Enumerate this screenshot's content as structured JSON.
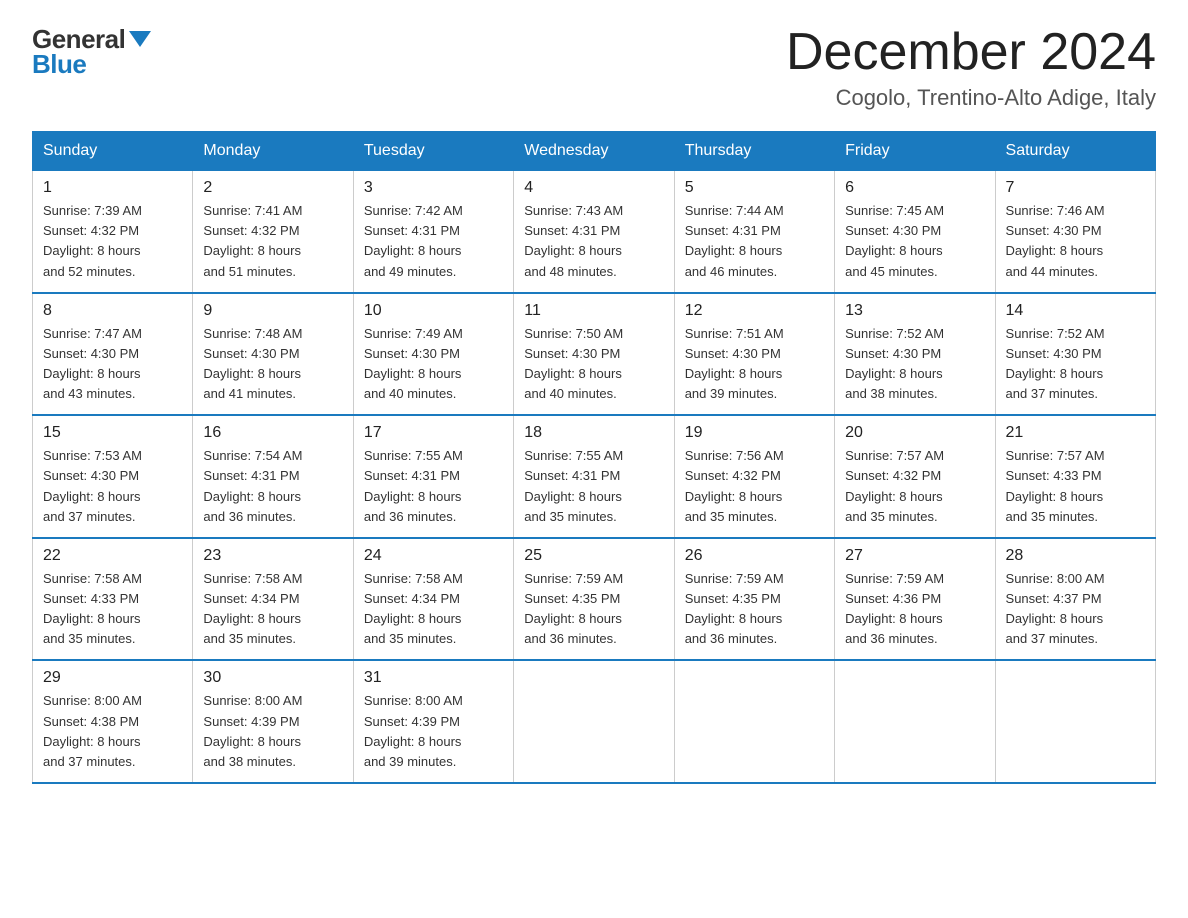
{
  "header": {
    "logo_general": "General",
    "logo_blue": "Blue",
    "month_year": "December 2024",
    "location": "Cogolo, Trentino-Alto Adige, Italy"
  },
  "days_of_week": [
    "Sunday",
    "Monday",
    "Tuesday",
    "Wednesday",
    "Thursday",
    "Friday",
    "Saturday"
  ],
  "weeks": [
    [
      {
        "day": "1",
        "sunrise": "7:39 AM",
        "sunset": "4:32 PM",
        "daylight": "8 hours and 52 minutes."
      },
      {
        "day": "2",
        "sunrise": "7:41 AM",
        "sunset": "4:32 PM",
        "daylight": "8 hours and 51 minutes."
      },
      {
        "day": "3",
        "sunrise": "7:42 AM",
        "sunset": "4:31 PM",
        "daylight": "8 hours and 49 minutes."
      },
      {
        "day": "4",
        "sunrise": "7:43 AM",
        "sunset": "4:31 PM",
        "daylight": "8 hours and 48 minutes."
      },
      {
        "day": "5",
        "sunrise": "7:44 AM",
        "sunset": "4:31 PM",
        "daylight": "8 hours and 46 minutes."
      },
      {
        "day": "6",
        "sunrise": "7:45 AM",
        "sunset": "4:30 PM",
        "daylight": "8 hours and 45 minutes."
      },
      {
        "day": "7",
        "sunrise": "7:46 AM",
        "sunset": "4:30 PM",
        "daylight": "8 hours and 44 minutes."
      }
    ],
    [
      {
        "day": "8",
        "sunrise": "7:47 AM",
        "sunset": "4:30 PM",
        "daylight": "8 hours and 43 minutes."
      },
      {
        "day": "9",
        "sunrise": "7:48 AM",
        "sunset": "4:30 PM",
        "daylight": "8 hours and 41 minutes."
      },
      {
        "day": "10",
        "sunrise": "7:49 AM",
        "sunset": "4:30 PM",
        "daylight": "8 hours and 40 minutes."
      },
      {
        "day": "11",
        "sunrise": "7:50 AM",
        "sunset": "4:30 PM",
        "daylight": "8 hours and 40 minutes."
      },
      {
        "day": "12",
        "sunrise": "7:51 AM",
        "sunset": "4:30 PM",
        "daylight": "8 hours and 39 minutes."
      },
      {
        "day": "13",
        "sunrise": "7:52 AM",
        "sunset": "4:30 PM",
        "daylight": "8 hours and 38 minutes."
      },
      {
        "day": "14",
        "sunrise": "7:52 AM",
        "sunset": "4:30 PM",
        "daylight": "8 hours and 37 minutes."
      }
    ],
    [
      {
        "day": "15",
        "sunrise": "7:53 AM",
        "sunset": "4:30 PM",
        "daylight": "8 hours and 37 minutes."
      },
      {
        "day": "16",
        "sunrise": "7:54 AM",
        "sunset": "4:31 PM",
        "daylight": "8 hours and 36 minutes."
      },
      {
        "day": "17",
        "sunrise": "7:55 AM",
        "sunset": "4:31 PM",
        "daylight": "8 hours and 36 minutes."
      },
      {
        "day": "18",
        "sunrise": "7:55 AM",
        "sunset": "4:31 PM",
        "daylight": "8 hours and 35 minutes."
      },
      {
        "day": "19",
        "sunrise": "7:56 AM",
        "sunset": "4:32 PM",
        "daylight": "8 hours and 35 minutes."
      },
      {
        "day": "20",
        "sunrise": "7:57 AM",
        "sunset": "4:32 PM",
        "daylight": "8 hours and 35 minutes."
      },
      {
        "day": "21",
        "sunrise": "7:57 AM",
        "sunset": "4:33 PM",
        "daylight": "8 hours and 35 minutes."
      }
    ],
    [
      {
        "day": "22",
        "sunrise": "7:58 AM",
        "sunset": "4:33 PM",
        "daylight": "8 hours and 35 minutes."
      },
      {
        "day": "23",
        "sunrise": "7:58 AM",
        "sunset": "4:34 PM",
        "daylight": "8 hours and 35 minutes."
      },
      {
        "day": "24",
        "sunrise": "7:58 AM",
        "sunset": "4:34 PM",
        "daylight": "8 hours and 35 minutes."
      },
      {
        "day": "25",
        "sunrise": "7:59 AM",
        "sunset": "4:35 PM",
        "daylight": "8 hours and 36 minutes."
      },
      {
        "day": "26",
        "sunrise": "7:59 AM",
        "sunset": "4:35 PM",
        "daylight": "8 hours and 36 minutes."
      },
      {
        "day": "27",
        "sunrise": "7:59 AM",
        "sunset": "4:36 PM",
        "daylight": "8 hours and 36 minutes."
      },
      {
        "day": "28",
        "sunrise": "8:00 AM",
        "sunset": "4:37 PM",
        "daylight": "8 hours and 37 minutes."
      }
    ],
    [
      {
        "day": "29",
        "sunrise": "8:00 AM",
        "sunset": "4:38 PM",
        "daylight": "8 hours and 37 minutes."
      },
      {
        "day": "30",
        "sunrise": "8:00 AM",
        "sunset": "4:39 PM",
        "daylight": "8 hours and 38 minutes."
      },
      {
        "day": "31",
        "sunrise": "8:00 AM",
        "sunset": "4:39 PM",
        "daylight": "8 hours and 39 minutes."
      },
      null,
      null,
      null,
      null
    ]
  ],
  "labels": {
    "sunrise": "Sunrise:",
    "sunset": "Sunset:",
    "daylight": "Daylight:"
  }
}
